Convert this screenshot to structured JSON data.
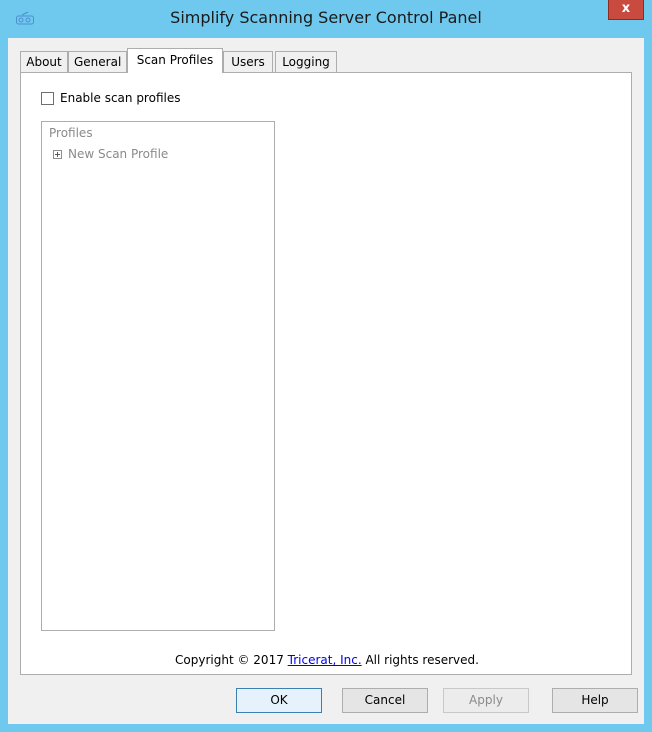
{
  "window": {
    "title": "Simplify Scanning Server Control Panel",
    "close_glyph": "x"
  },
  "tabs": [
    {
      "label": "About"
    },
    {
      "label": "General"
    },
    {
      "label": "Scan Profiles",
      "active": true
    },
    {
      "label": "Users"
    },
    {
      "label": "Logging"
    }
  ],
  "scan_profiles": {
    "enable_label": "Enable scan profiles",
    "enable_checked": false,
    "group_title": "Profiles",
    "tree_items": [
      {
        "label": "New Scan Profile",
        "expander": "+"
      }
    ]
  },
  "footer": {
    "copyright_prefix": "Copyright © 2017 ",
    "company_link": "Tricerat, Inc.",
    "copyright_suffix": " All rights reserved."
  },
  "buttons": {
    "ok": "OK",
    "cancel": "Cancel",
    "apply": "Apply",
    "help": "Help"
  },
  "colors": {
    "titlebar": "#6fc9ef",
    "client": "#f0f0f0",
    "close": "#c94a3f",
    "link": "#0000ee"
  }
}
